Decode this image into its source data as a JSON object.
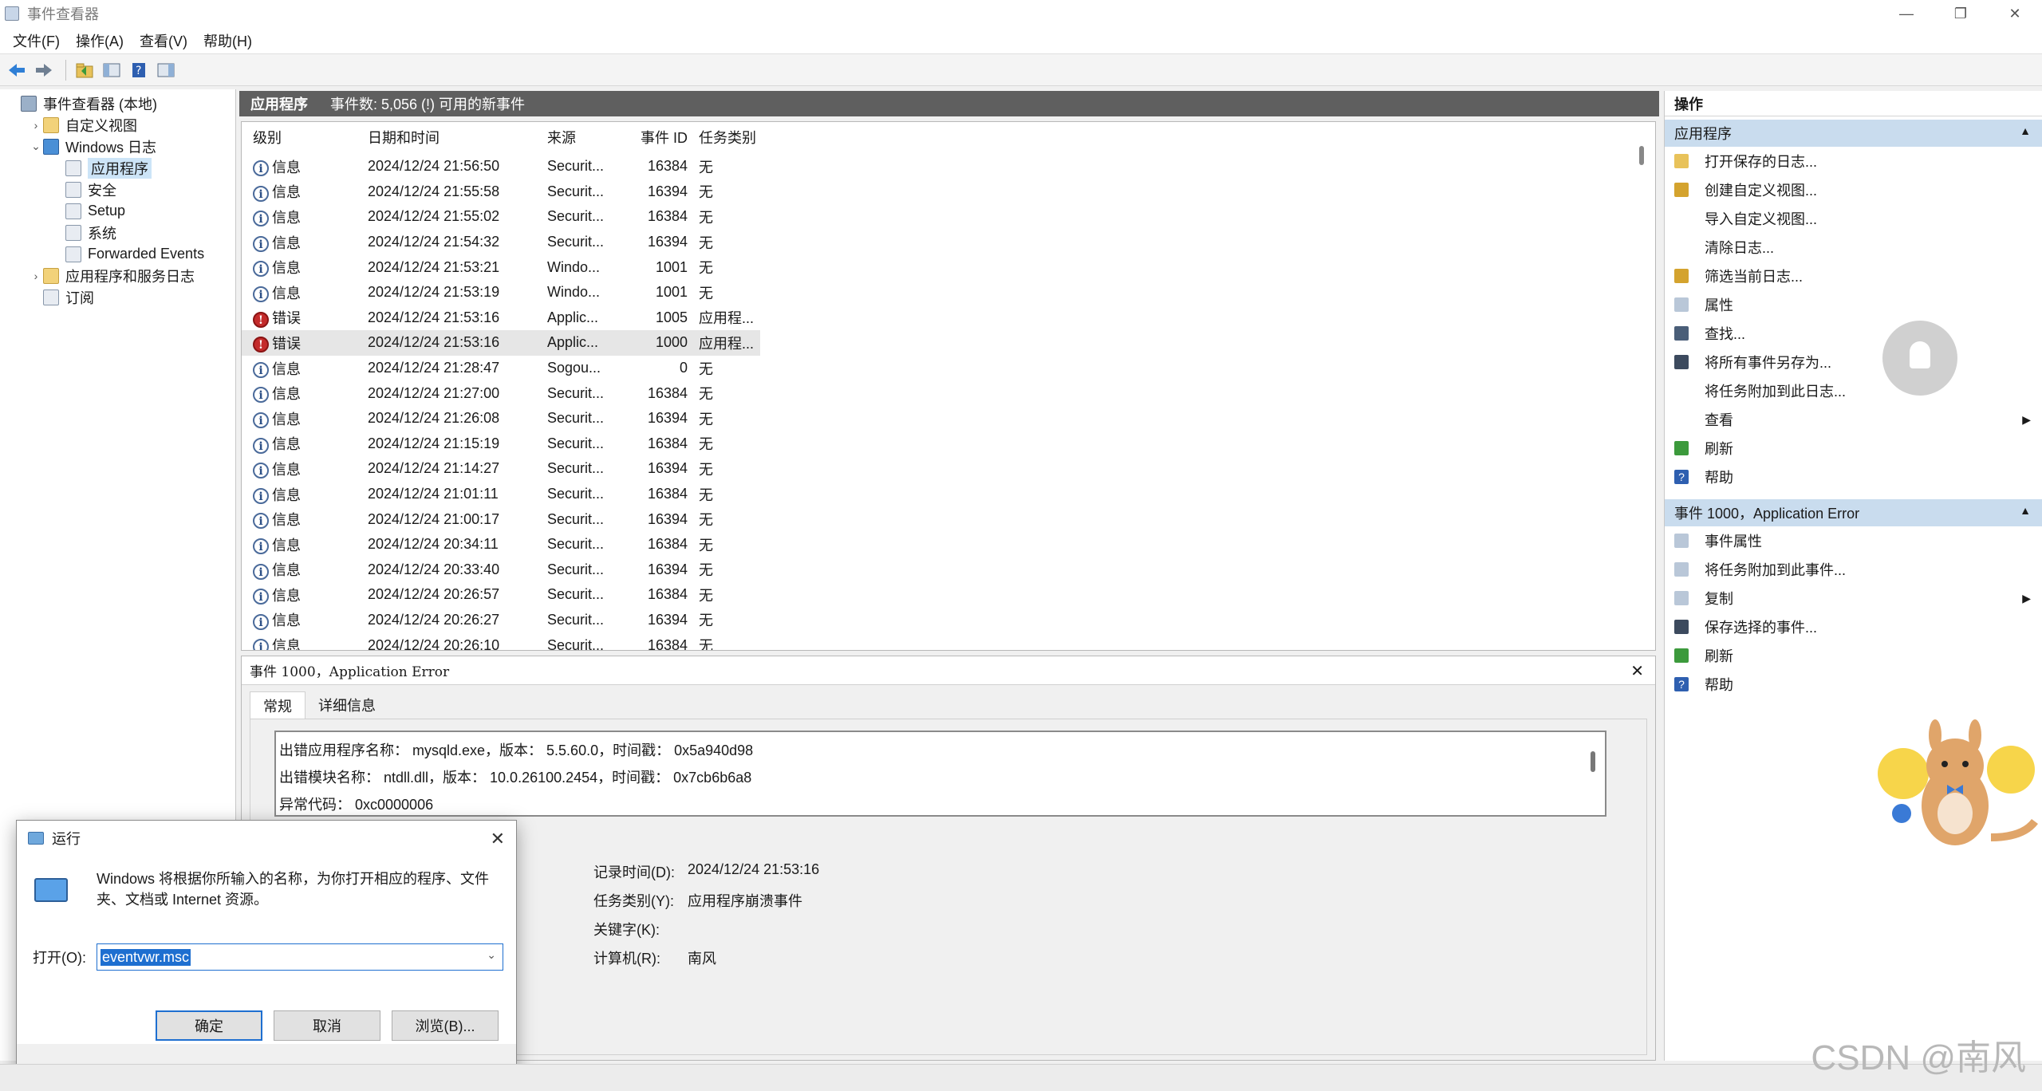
{
  "window": {
    "title": "事件查看器",
    "minimize": "—",
    "restore": "❐",
    "close": "✕"
  },
  "menu": [
    "文件(F)",
    "操作(A)",
    "查看(V)",
    "帮助(H)"
  ],
  "tree": [
    {
      "label": "事件查看器 (本地)",
      "indent": 0,
      "exp": "",
      "icon": "root"
    },
    {
      "label": "自定义视图",
      "indent": 1,
      "exp": "›",
      "icon": "folder"
    },
    {
      "label": "Windows 日志",
      "indent": 1,
      "exp": "⌄",
      "icon": "winlog"
    },
    {
      "label": "应用程序",
      "indent": 2,
      "exp": "",
      "icon": "log",
      "selected": true
    },
    {
      "label": "安全",
      "indent": 2,
      "exp": "",
      "icon": "log"
    },
    {
      "label": "Setup",
      "indent": 2,
      "exp": "",
      "icon": "log"
    },
    {
      "label": "系统",
      "indent": 2,
      "exp": "",
      "icon": "log"
    },
    {
      "label": "Forwarded Events",
      "indent": 2,
      "exp": "",
      "icon": "log"
    },
    {
      "label": "应用程序和服务日志",
      "indent": 1,
      "exp": "›",
      "icon": "folder"
    },
    {
      "label": "订阅",
      "indent": 1,
      "exp": "",
      "icon": "log"
    }
  ],
  "center": {
    "title": "应用程序",
    "count": "事件数: 5,056 (!) 可用的新事件"
  },
  "columns": [
    "级别",
    "日期和时间",
    "来源",
    "事件 ID",
    "任务类别"
  ],
  "events": [
    {
      "level": "信息",
      "type": "info",
      "date": "2024/12/24 21:56:50",
      "source": "Securit...",
      "id": "16384",
      "task": "无"
    },
    {
      "level": "信息",
      "type": "info",
      "date": "2024/12/24 21:55:58",
      "source": "Securit...",
      "id": "16394",
      "task": "无"
    },
    {
      "level": "信息",
      "type": "info",
      "date": "2024/12/24 21:55:02",
      "source": "Securit...",
      "id": "16384",
      "task": "无"
    },
    {
      "level": "信息",
      "type": "info",
      "date": "2024/12/24 21:54:32",
      "source": "Securit...",
      "id": "16394",
      "task": "无"
    },
    {
      "level": "信息",
      "type": "info",
      "date": "2024/12/24 21:53:21",
      "source": "Windo...",
      "id": "1001",
      "task": "无"
    },
    {
      "level": "信息",
      "type": "info",
      "date": "2024/12/24 21:53:19",
      "source": "Windo...",
      "id": "1001",
      "task": "无"
    },
    {
      "level": "错误",
      "type": "error",
      "date": "2024/12/24 21:53:16",
      "source": "Applic...",
      "id": "1005",
      "task": "应用程..."
    },
    {
      "level": "错误",
      "type": "error",
      "date": "2024/12/24 21:53:16",
      "source": "Applic...",
      "id": "1000",
      "task": "应用程...",
      "highlight": true
    },
    {
      "level": "信息",
      "type": "info",
      "date": "2024/12/24 21:28:47",
      "source": "Sogou...",
      "id": "0",
      "task": "无"
    },
    {
      "level": "信息",
      "type": "info",
      "date": "2024/12/24 21:27:00",
      "source": "Securit...",
      "id": "16384",
      "task": "无"
    },
    {
      "level": "信息",
      "type": "info",
      "date": "2024/12/24 21:26:08",
      "source": "Securit...",
      "id": "16394",
      "task": "无"
    },
    {
      "level": "信息",
      "type": "info",
      "date": "2024/12/24 21:15:19",
      "source": "Securit...",
      "id": "16384",
      "task": "无"
    },
    {
      "level": "信息",
      "type": "info",
      "date": "2024/12/24 21:14:27",
      "source": "Securit...",
      "id": "16394",
      "task": "无"
    },
    {
      "level": "信息",
      "type": "info",
      "date": "2024/12/24 21:01:11",
      "source": "Securit...",
      "id": "16384",
      "task": "无"
    },
    {
      "level": "信息",
      "type": "info",
      "date": "2024/12/24 21:00:17",
      "source": "Securit...",
      "id": "16394",
      "task": "无"
    },
    {
      "level": "信息",
      "type": "info",
      "date": "2024/12/24 20:34:11",
      "source": "Securit...",
      "id": "16384",
      "task": "无"
    },
    {
      "level": "信息",
      "type": "info",
      "date": "2024/12/24 20:33:40",
      "source": "Securit...",
      "id": "16394",
      "task": "无"
    },
    {
      "level": "信息",
      "type": "info",
      "date": "2024/12/24 20:26:57",
      "source": "Securit...",
      "id": "16384",
      "task": "无"
    },
    {
      "level": "信息",
      "type": "info",
      "date": "2024/12/24 20:26:27",
      "source": "Securit...",
      "id": "16394",
      "task": "无"
    },
    {
      "level": "信息",
      "type": "info",
      "date": "2024/12/24 20:26:10",
      "source": "Securit...",
      "id": "16384",
      "task": "无"
    }
  ],
  "detail": {
    "header": "事件 1000，Application Error",
    "close": "✕",
    "tabs": [
      "常规",
      "详细信息"
    ],
    "desc_lines": [
      "出错应用程序名称： mysqld.exe，版本： 5.5.60.0，时间戳： 0x5a940d98",
      "出错模块名称： ntdll.dll，版本： 10.0.26100.2454，时间戳： 0x7cb6b6a8",
      "异常代码： 0xc0000006"
    ],
    "fields": [
      {
        "k": "记录时间(D):",
        "v": "2024/12/24 21:53:16"
      },
      {
        "k": "任务类别(Y):",
        "v": "应用程序崩溃事件"
      },
      {
        "k": "关键字(K):",
        "v": ""
      },
      {
        "k": "计算机(R):",
        "v": "南风"
      }
    ]
  },
  "actions": {
    "title": "操作",
    "section1": "应用程序",
    "items1": [
      {
        "label": "打开保存的日志...",
        "icon": "open-folder-icon"
      },
      {
        "label": "创建自定义视图...",
        "icon": "filter-icon"
      },
      {
        "label": "导入自定义视图...",
        "icon": ""
      },
      {
        "label": "清除日志...",
        "icon": ""
      },
      {
        "label": "筛选当前日志...",
        "icon": "filter-icon"
      },
      {
        "label": "属性",
        "icon": "properties-icon"
      },
      {
        "label": "查找...",
        "icon": "binoculars-icon"
      },
      {
        "label": "将所有事件另存为...",
        "icon": "save-icon"
      },
      {
        "label": "将任务附加到此日志...",
        "icon": ""
      },
      {
        "label": "查看",
        "icon": "",
        "arrow": true
      },
      {
        "label": "刷新",
        "icon": "refresh-icon"
      },
      {
        "label": "帮助",
        "icon": "help-icon"
      }
    ],
    "section2": "事件 1000，Application Error",
    "items2": [
      {
        "label": "事件属性",
        "icon": "properties-icon"
      },
      {
        "label": "将任务附加到此事件...",
        "icon": "task-icon"
      },
      {
        "label": "复制",
        "icon": "copy-icon",
        "arrow": true
      },
      {
        "label": "保存选择的事件...",
        "icon": "save-icon"
      },
      {
        "label": "刷新",
        "icon": "refresh-icon"
      },
      {
        "label": "帮助",
        "icon": "help-icon"
      }
    ]
  },
  "run": {
    "title": "运行",
    "close": "✕",
    "text": "Windows 将根据你所输入的名称，为你打开相应的程序、文件夹、文档或 Internet 资源。",
    "open_label": "打开(O):",
    "value": "eventvwr.msc",
    "ok": "确定",
    "cancel": "取消",
    "browse": "浏览(B)..."
  },
  "watermark": "CSDN @南风"
}
